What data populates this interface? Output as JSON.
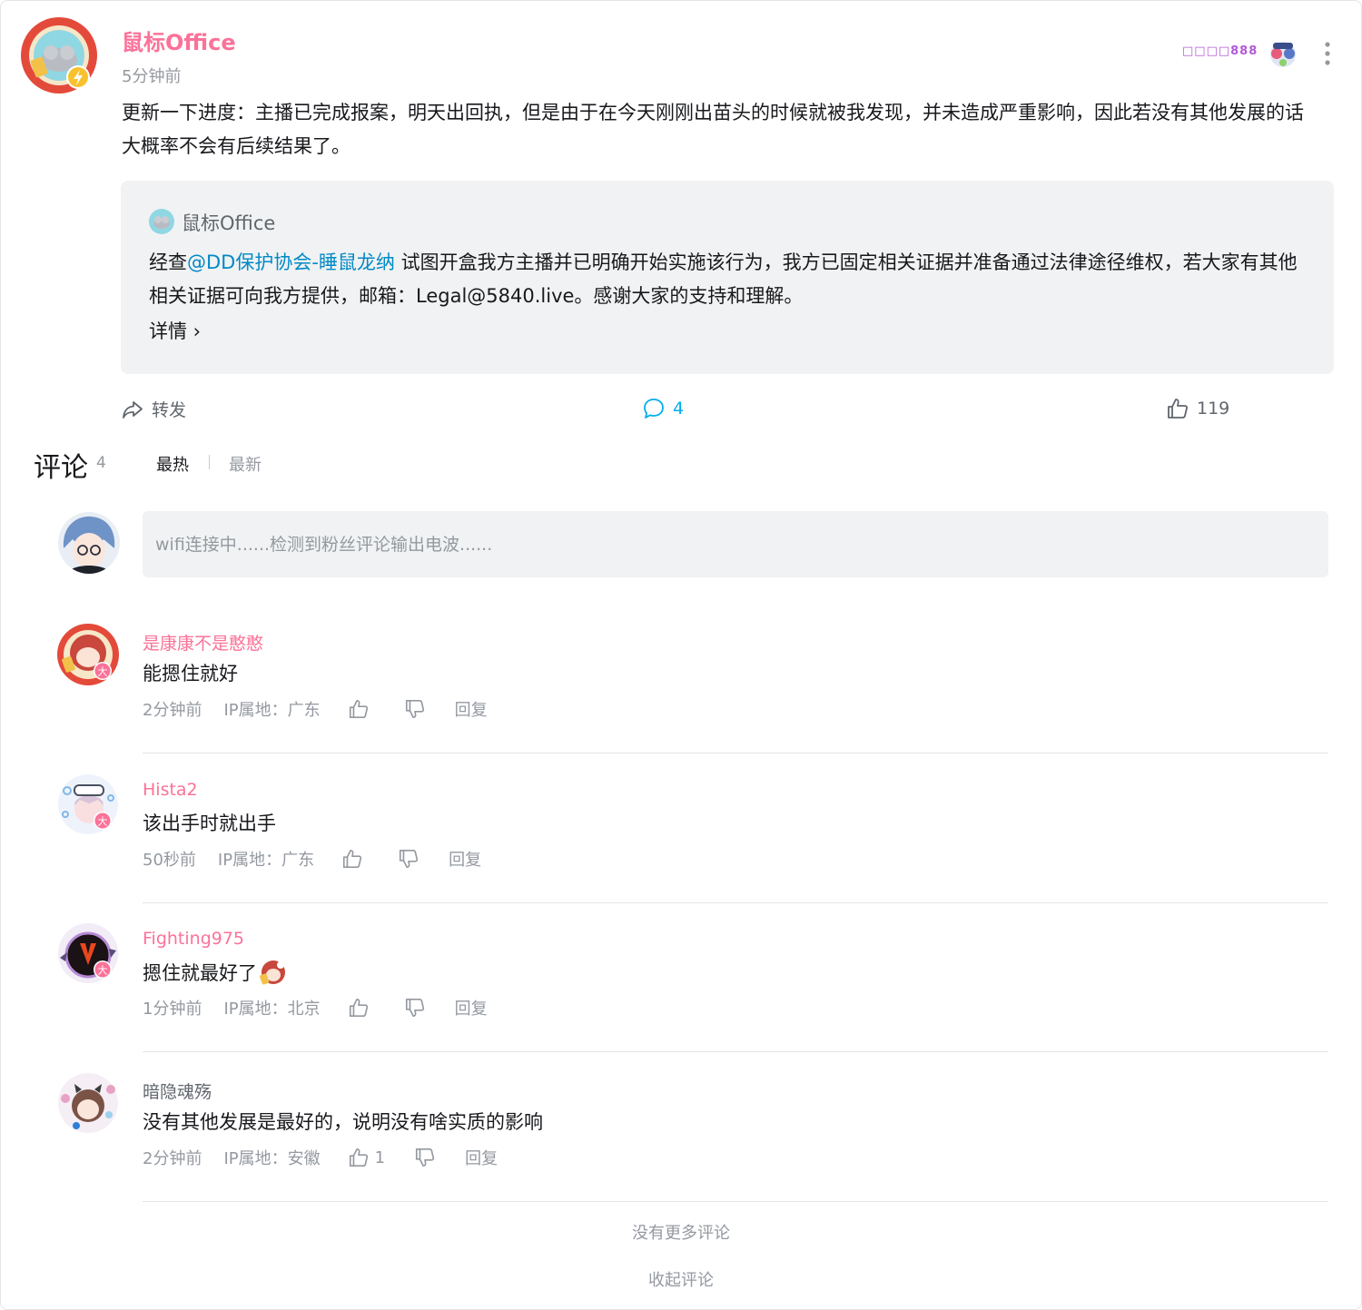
{
  "post": {
    "author": "鼠标Office",
    "time": "5分钟前",
    "fan_badge": "□□□□888",
    "text": "更新一下进度：主播已完成报案，明天出回执，但是由于在今天刚刚出苗头的时候就被我发现，并未造成严重影响，因此若没有其他发展的话大概率不会有后续结果了。",
    "repost": {
      "author": "鼠标Office",
      "text_prefix": "经查",
      "mention": "@DD保护协会-睡鼠龙纳",
      "text_suffix": " 试图开盒我方主播并已明确开始实施该行为，我方已固定相关证据并准备通过法律途径维权，若大家有其他相关证据可向我方提供，邮箱：Legal@5840.live。感谢大家的支持和理解。",
      "details": "详情 ›"
    },
    "actions": {
      "forward": "转发",
      "comments": "4",
      "likes": "119"
    }
  },
  "comments_header": {
    "title": "评论",
    "count": "4",
    "sort_hot": "最热",
    "sort_new": "最新"
  },
  "compose": {
    "placeholder": "wifi连接中......检测到粉丝评论输出电波......"
  },
  "comments": [
    {
      "name": "是康康不是憨憨",
      "text": "能摁住就好",
      "time": "2分钟前",
      "ip": "IP属地：广东",
      "likes": "",
      "reply": "回复"
    },
    {
      "name": "Hista2",
      "text": "该出手时就出手",
      "time": "50秒前",
      "ip": "IP属地：广东",
      "likes": "",
      "reply": "回复"
    },
    {
      "name": "Fighting975",
      "text": "摁住就最好了",
      "time": "1分钟前",
      "ip": "IP属地：北京",
      "likes": "",
      "reply": "回复"
    },
    {
      "name": "暗隐魂殇",
      "text": "没有其他发展是最好的，说明没有啥实质的影响",
      "time": "2分钟前",
      "ip": "IP属地：安徽",
      "likes": "1",
      "reply": "回复"
    }
  ],
  "footer": {
    "no_more": "没有更多评论",
    "collapse": "收起评论"
  },
  "colors": {
    "accent_pink": "#fb7299",
    "link_blue": "#008ac5",
    "comment_blue": "#00aeec",
    "gray_text": "#9499a0"
  }
}
